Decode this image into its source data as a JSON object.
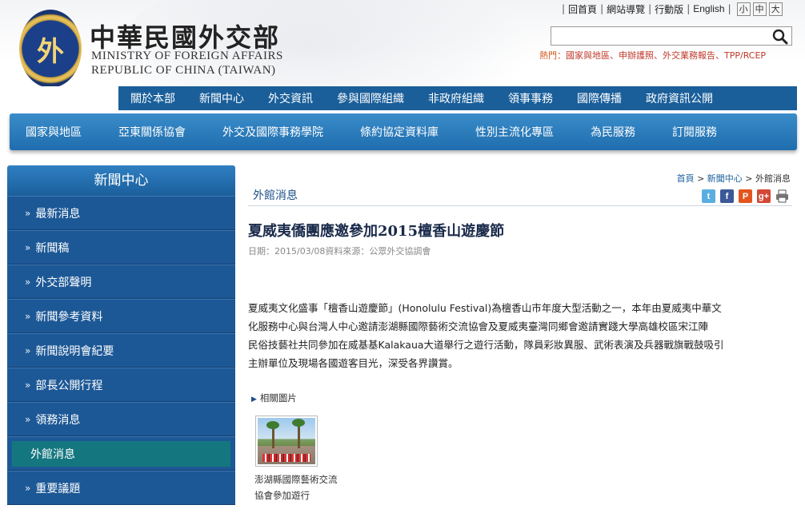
{
  "header": {
    "logo_cn": "中華民國外交部",
    "logo_en_line1": "MINISTRY OF FOREIGN AFFAIRS",
    "logo_en_line2": "REPUBLIC OF CHINA (TAIWAN)",
    "seal_char": "外",
    "top_links": [
      "回首頁",
      "網站導覽",
      "行動版",
      "English"
    ],
    "font_sizes": [
      "小",
      "中",
      "大"
    ],
    "search_placeholder": "",
    "hot_label": "熱門：",
    "hot_links": "國家與地區、申辦護照、外交業務報告、TPP/RCEP"
  },
  "nav_primary": [
    "關於本部",
    "新聞中心",
    "外交資訊",
    "參與國際組織",
    "非政府組織",
    "領事事務",
    "國際傳播",
    "政府資訊公開"
  ],
  "nav_secondary": [
    "國家與地區",
    "亞東關係協會",
    "外交及國際事務學院",
    "條約協定資料庫",
    "性別主流化專區",
    "為民服務",
    "訂閱服務"
  ],
  "sidebar": {
    "title": "新聞中心",
    "items": [
      {
        "label": "最新消息",
        "active": false
      },
      {
        "label": "新聞稿",
        "active": false
      },
      {
        "label": "外交部聲明",
        "active": false
      },
      {
        "label": "新聞參考資料",
        "active": false
      },
      {
        "label": "新聞說明會紀要",
        "active": false
      },
      {
        "label": "部長公開行程",
        "active": false
      },
      {
        "label": "領務消息",
        "active": false
      },
      {
        "label": "外館消息",
        "active": true
      },
      {
        "label": "重要議題",
        "active": false
      }
    ]
  },
  "breadcrumb": {
    "home": "首頁",
    "sep": ">",
    "level1": "新聞中心",
    "current": "外館消息"
  },
  "section_title": "外館消息",
  "share_icons": [
    "twitter-icon",
    "facebook-icon",
    "plurk-icon",
    "google-plus-icon",
    "print-icon"
  ],
  "article": {
    "title": "夏威夷僑團應邀參加2015檀香山遊慶節",
    "meta": "日期：2015/03/08資料來源：公眾外交協調會",
    "body_lines": [
      "夏威夷文化盛事「檀香山遊慶節」(Honolulu Festival)為檀香山市年度大型活動之一，本年由夏威夷中華文",
      "化服務中心與台灣人中心邀請澎湖縣國際藝術交流協會及夏威夷臺灣同鄉會邀請實踐大學高雄校區宋江陣",
      "民俗技藝社共同參加在威基基Kalakaua大道舉行之遊行活動，隊員彩妝異服、武術表演及兵器戰旗戰鼓吸引",
      "主辦單位及現場各國遊客目光，深受各界讚賞。"
    ],
    "related_label": "相關圖片",
    "photo_caption": "澎湖縣國際藝術交流協會參加遊行"
  }
}
